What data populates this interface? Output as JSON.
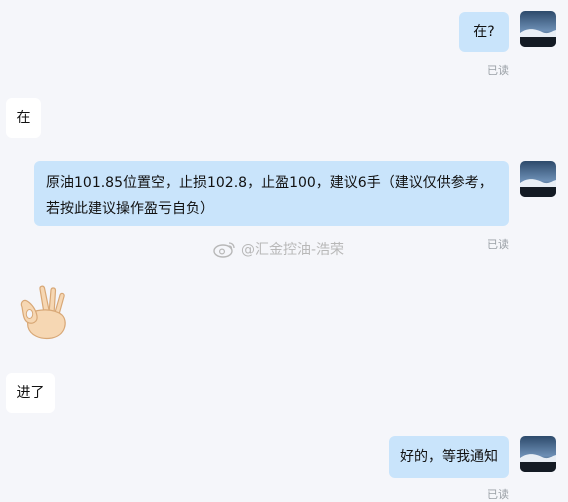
{
  "messages": [
    {
      "direction": "out",
      "text": "在?",
      "status": "已读"
    },
    {
      "direction": "in",
      "text": "在"
    },
    {
      "direction": "out",
      "text": "原油101.85位置空，止损102.8，止盈100，建议6手（建议仅供参考，若按此建议操作盈亏自负）",
      "status": "已读"
    },
    {
      "direction": "in",
      "emoji": "ok-hand"
    },
    {
      "direction": "in",
      "text": "进了"
    },
    {
      "direction": "out",
      "text": "好的，等我通知",
      "status": "已读"
    }
  ],
  "watermark": {
    "text": "@汇金控油-浩荣",
    "icon": "weibo-icon"
  },
  "colors": {
    "background": "#f5f6fa",
    "outgoing_bubble": "#c9e4fb",
    "incoming_bubble": "#ffffff",
    "read_status": "#9aa0a6"
  }
}
